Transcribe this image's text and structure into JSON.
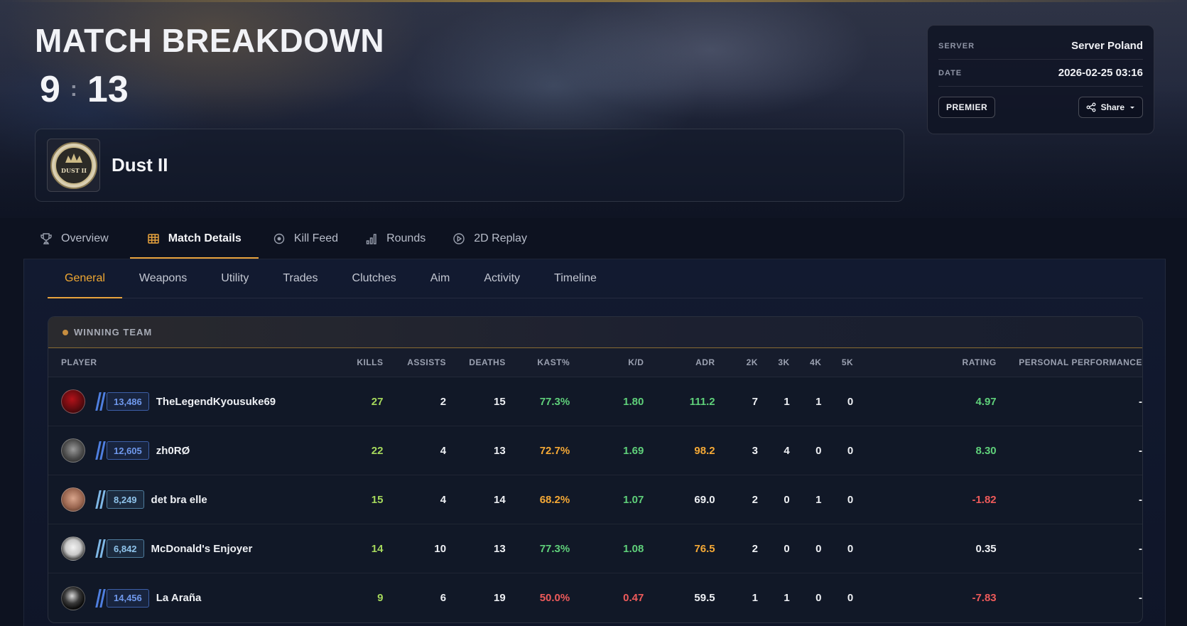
{
  "hero": {
    "title": "MATCH BREAKDOWN",
    "score_left": "9",
    "score_sep": ":",
    "score_right": "13",
    "map_name": "Dust II",
    "map_logo_text": "DUST II"
  },
  "info": {
    "server_label": "SERVER",
    "server_value": "Server Poland",
    "date_label": "DATE",
    "date_value": "2026-02-25 03:16",
    "mode_button": "PREMIER",
    "share_button": "Share"
  },
  "main_tabs": [
    {
      "label": "Overview",
      "icon": "trophy-icon"
    },
    {
      "label": "Match Details",
      "icon": "table-icon",
      "active": true
    },
    {
      "label": "Kill Feed",
      "icon": "target-icon"
    },
    {
      "label": "Rounds",
      "icon": "bar-chart-icon"
    },
    {
      "label": "2D Replay",
      "icon": "play-circle-icon"
    }
  ],
  "sub_tabs": [
    "General",
    "Weapons",
    "Utility",
    "Trades",
    "Clutches",
    "Aim",
    "Activity",
    "Timeline"
  ],
  "team": {
    "title": "WINNING TEAM",
    "columns": [
      "PLAYER",
      "KILLS",
      "ASSISTS",
      "DEATHS",
      "KAST%",
      "K/D",
      "ADR",
      "2K",
      "3K",
      "4K",
      "5K",
      "RATING",
      "PERSONAL PERFORMANCE"
    ],
    "players": [
      {
        "name": "TheLegendKyousuke69",
        "rank": "13,486",
        "kills": "27",
        "assists": "2",
        "deaths": "15",
        "kast": "77.3%",
        "kd": "1.80",
        "adr": "111.2",
        "k2": "7",
        "k3": "1",
        "k4": "1",
        "k5": "0",
        "rating": "4.97",
        "perf": "-"
      },
      {
        "name": "zh0RØ",
        "rank": "12,605",
        "kills": "22",
        "assists": "4",
        "deaths": "13",
        "kast": "72.7%",
        "kd": "1.69",
        "adr": "98.2",
        "k2": "3",
        "k3": "4",
        "k4": "0",
        "k5": "0",
        "rating": "8.30",
        "perf": "-"
      },
      {
        "name": "det bra elle",
        "rank": "8,249",
        "kills": "15",
        "assists": "4",
        "deaths": "14",
        "kast": "68.2%",
        "kd": "1.07",
        "adr": "69.0",
        "k2": "2",
        "k3": "0",
        "k4": "1",
        "k5": "0",
        "rating": "-1.82",
        "perf": "-"
      },
      {
        "name": "McDonald's Enjoyer",
        "rank": "6,842",
        "kills": "14",
        "assists": "10",
        "deaths": "13",
        "kast": "77.3%",
        "kd": "1.08",
        "adr": "76.5",
        "k2": "2",
        "k3": "0",
        "k4": "0",
        "k5": "0",
        "rating": "0.35",
        "perf": "-"
      },
      {
        "name": "La Araña",
        "rank": "14,456",
        "kills": "9",
        "assists": "6",
        "deaths": "19",
        "kast": "50.0%",
        "kd": "0.47",
        "adr": "59.5",
        "k2": "1",
        "k3": "1",
        "k4": "0",
        "k5": "0",
        "rating": "-7.83",
        "perf": "-"
      }
    ]
  },
  "colors": {
    "accent": "#e8a33d",
    "green": "#5fd07a",
    "amber": "#f5a936",
    "red": "#ee5a5a",
    "rank_blue": "#4f7fe0",
    "rank_lightblue": "#7fb8e6"
  }
}
